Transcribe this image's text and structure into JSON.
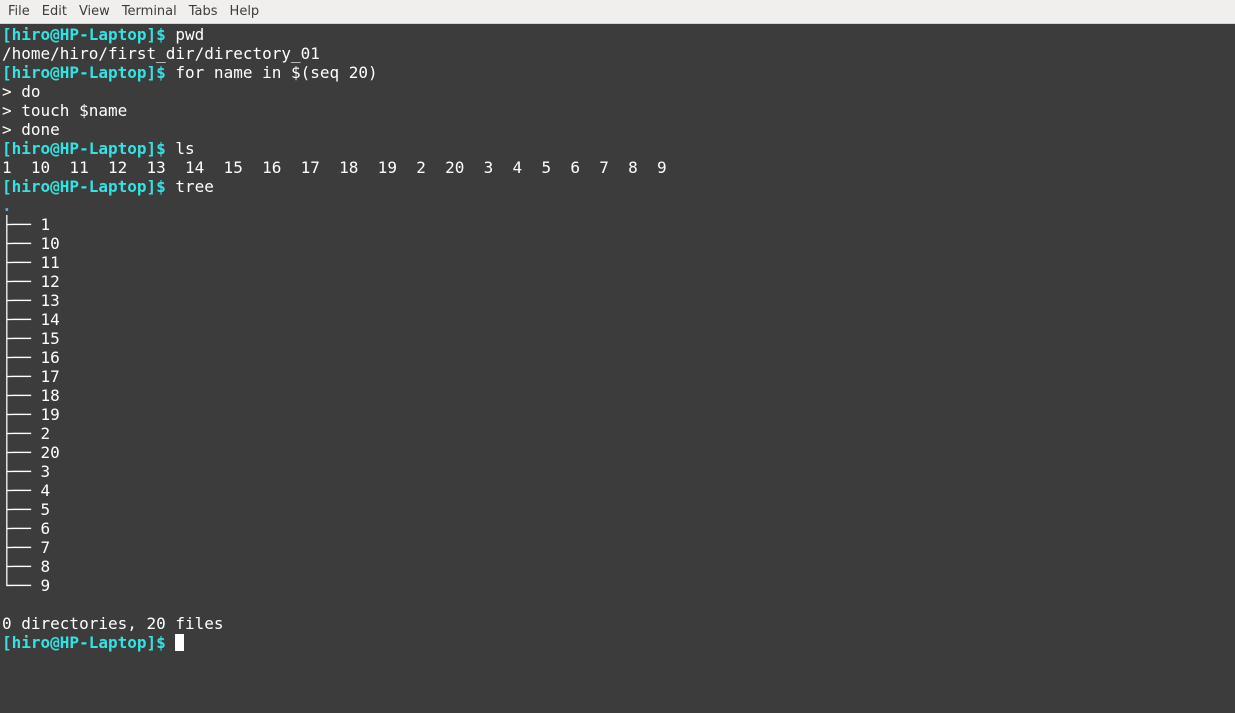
{
  "menu": {
    "items": [
      {
        "label": "File"
      },
      {
        "label": "Edit"
      },
      {
        "label": "View"
      },
      {
        "label": "Terminal"
      },
      {
        "label": "Tabs"
      },
      {
        "label": "Help"
      }
    ]
  },
  "terminal": {
    "prompt": "[hiro@HP-Laptop]$",
    "lines": [
      {
        "kind": "command",
        "prompt": "[hiro@HP-Laptop]$",
        "text": " pwd"
      },
      {
        "kind": "output",
        "text": "/home/hiro/first_dir/directory_01"
      },
      {
        "kind": "command",
        "prompt": "[hiro@HP-Laptop]$",
        "text": " for name in $(seq 20)"
      },
      {
        "kind": "output",
        "text": "> do"
      },
      {
        "kind": "output",
        "text": "> touch $name"
      },
      {
        "kind": "output",
        "text": "> done"
      },
      {
        "kind": "command",
        "prompt": "[hiro@HP-Laptop]$",
        "text": " ls"
      },
      {
        "kind": "output",
        "text": "1  10  11  12  13  14  15  16  17  18  19  2  20  3  4  5  6  7  8  9"
      },
      {
        "kind": "command",
        "prompt": "[hiro@HP-Laptop]$",
        "text": " tree"
      },
      {
        "kind": "tree-root",
        "text": "."
      },
      {
        "kind": "output",
        "text": "├── 1"
      },
      {
        "kind": "output",
        "text": "├── 10"
      },
      {
        "kind": "output",
        "text": "├── 11"
      },
      {
        "kind": "output",
        "text": "├── 12"
      },
      {
        "kind": "output",
        "text": "├── 13"
      },
      {
        "kind": "output",
        "text": "├── 14"
      },
      {
        "kind": "output",
        "text": "├── 15"
      },
      {
        "kind": "output",
        "text": "├── 16"
      },
      {
        "kind": "output",
        "text": "├── 17"
      },
      {
        "kind": "output",
        "text": "├── 18"
      },
      {
        "kind": "output",
        "text": "├── 19"
      },
      {
        "kind": "output",
        "text": "├── 2"
      },
      {
        "kind": "output",
        "text": "├── 20"
      },
      {
        "kind": "output",
        "text": "├── 3"
      },
      {
        "kind": "output",
        "text": "├── 4"
      },
      {
        "kind": "output",
        "text": "├── 5"
      },
      {
        "kind": "output",
        "text": "├── 6"
      },
      {
        "kind": "output",
        "text": "├── 7"
      },
      {
        "kind": "output",
        "text": "├── 8"
      },
      {
        "kind": "output",
        "text": "└── 9"
      },
      {
        "kind": "blank",
        "text": ""
      },
      {
        "kind": "output",
        "text": "0 directories, 20 files"
      },
      {
        "kind": "current-prompt",
        "prompt": "[hiro@HP-Laptop]$",
        "text": " "
      }
    ]
  },
  "colors": {
    "background": "#3c3c3c",
    "prompt": "#34e2e2",
    "text": "#ffffff",
    "tree_root": "#729fcf",
    "menubar": "#f0efed"
  }
}
